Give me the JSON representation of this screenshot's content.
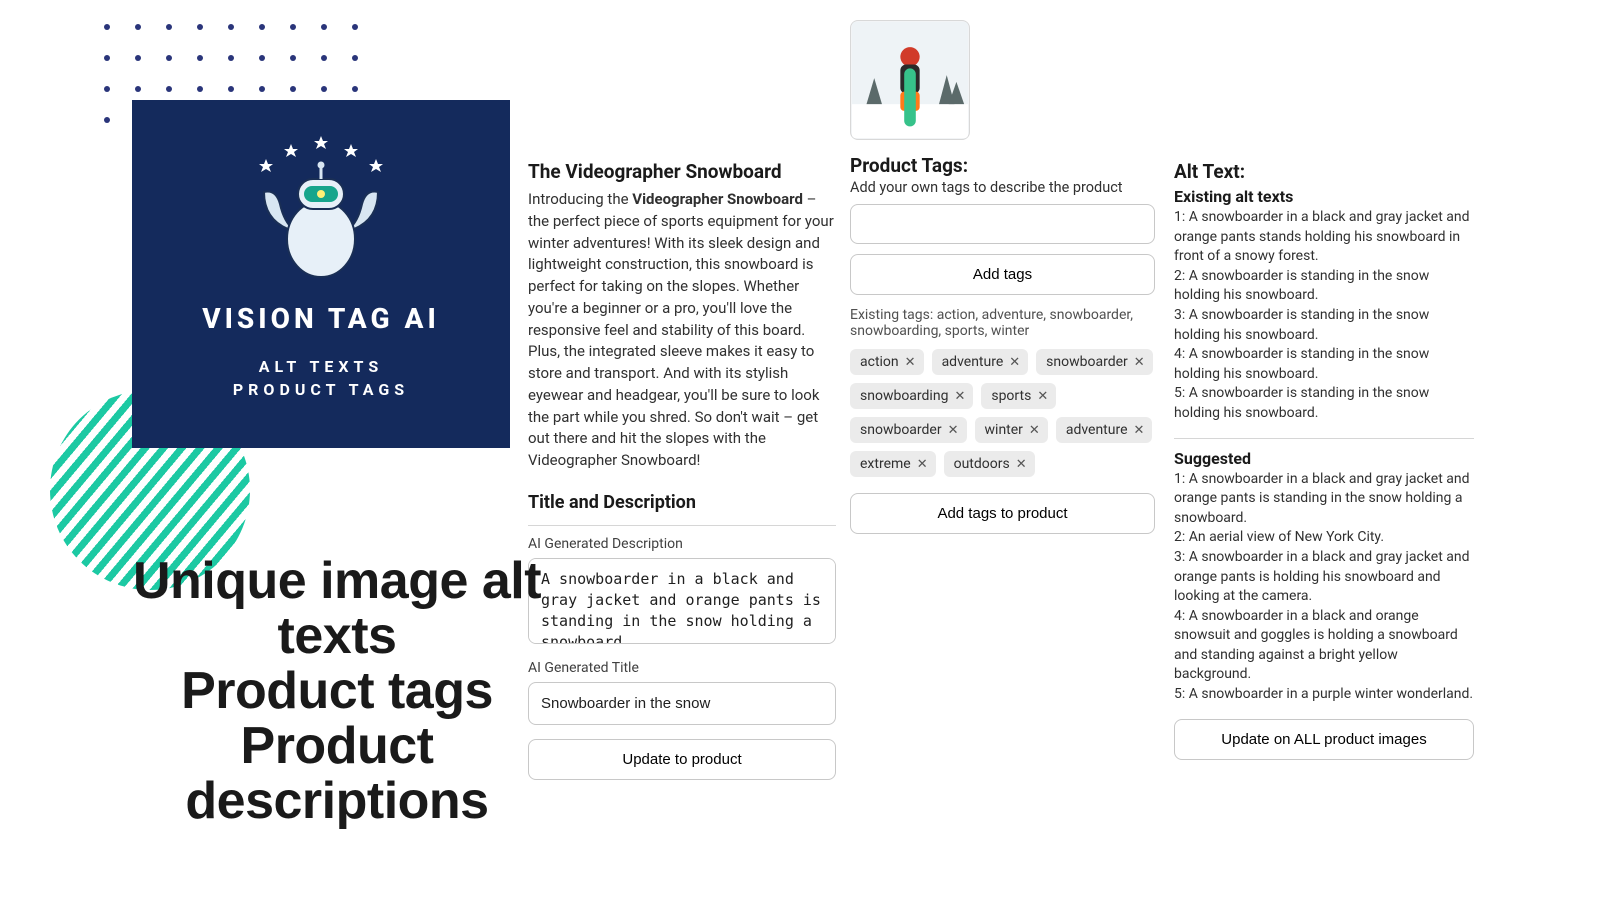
{
  "brand": {
    "title": "VISION TAG AI",
    "sub1": "ALT TEXTS",
    "sub2": "PRODUCT TAGS"
  },
  "hero": {
    "line1": "Unique image alt texts",
    "line2": "Product tags",
    "line3": "Product descriptions"
  },
  "product": {
    "title": "The Videographer Snowboard",
    "intro_prefix": "Introducing the ",
    "intro_bold": "Videographer Snowboard",
    "body": " – the perfect piece of sports equipment for your winter adventures! With its sleek design and lightweight construction, this snowboard is perfect for taking on the slopes. Whether you're a beginner or a pro, you'll love the responsive feel and stability of this board. Plus, the integrated sleeve makes it easy to store and transport. And with its stylish eyewear and headgear, you'll be sure to look the part while you shred. So don't wait – get out there and hit the slopes with the Videographer Snowboard!",
    "section_heading": "Title and Description",
    "ai_desc_label": "AI Generated Description",
    "ai_desc_value": "A snowboarder in a black and gray jacket and orange pants is standing in the snow holding a snowboard.",
    "ai_title_label": "AI Generated Title",
    "ai_title_value": "Snowboarder in the snow",
    "update_btn": "Update to product"
  },
  "tags": {
    "heading": "Product Tags:",
    "helper": "Add your own tags to describe the product",
    "add_placeholder": "",
    "add_btn": "Add tags",
    "existing_line": "Existing tags: action, adventure, snowboarder, snowboarding, sports, winter",
    "chips": [
      "action",
      "adventure",
      "snowboarder",
      "snowboarding",
      "sports",
      "snowboarder",
      "winter",
      "adventure",
      "extreme",
      "outdoors"
    ],
    "add_to_product_btn": "Add tags to product"
  },
  "alt": {
    "heading": "Alt Text:",
    "existing_heading": "Existing alt texts",
    "existing": [
      "A snowboarder in a black and gray jacket and orange pants stands holding his snowboard in front of a snowy forest.",
      "A snowboarder is standing in the snow holding his snowboard.",
      "A snowboarder is standing in the snow holding his snowboard.",
      "A snowboarder is standing in the snow holding his snowboard.",
      "A snowboarder is standing in the snow holding his snowboard."
    ],
    "suggested_heading": "Suggested",
    "suggested": [
      "A snowboarder in a black and gray jacket and orange pants is standing in the snow holding a snowboard.",
      "An aerial view of New York City.",
      "A snowboarder in a black and gray jacket and orange pants is holding his snowboard and looking at the camera.",
      "A snowboarder in a black and orange snowsuit and goggles is holding a snowboard and standing against a bright yellow background.",
      "A snowboarder in a purple winter wonderland."
    ],
    "update_btn": "Update on ALL product images"
  }
}
